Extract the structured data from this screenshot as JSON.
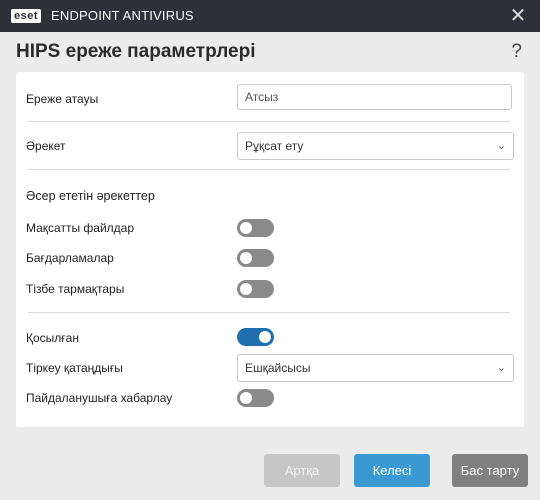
{
  "window": {
    "logo_text": "eset",
    "app_name": "ENDPOINT ANTIVIRUS",
    "close_glyph": "✕"
  },
  "dialog": {
    "title": "HIPS ереже параметрлері",
    "help_glyph": "?"
  },
  "form": {
    "rule_name_label": "Ереже атауы",
    "rule_name_placeholder": "Атсыз",
    "action_label": "Әрекет",
    "action_value": "Рұқсат ету",
    "affected_title": "Әсер ететін әрекеттер",
    "target_files_label": "Мақсатты файлдар",
    "target_files_on": false,
    "apps_label": "Бағдарламалар",
    "apps_on": false,
    "registry_label": "Тізбе тармақтары",
    "registry_on": false,
    "enabled_label": "Қосылған",
    "enabled_on": true,
    "log_label": "Тіркеу қатаңдығы",
    "log_value": "Ешқайсысы",
    "notify_label": "Пайдаланушыға хабарлау",
    "notify_on": false
  },
  "footer": {
    "back_label": "Артқа",
    "next_label": "Келесі",
    "cancel_label": "Бас тарту"
  },
  "colors": {
    "titlebar": "#2e3138",
    "toggle_on": "#1f6fb0",
    "toggle_off": "#8a8a8a",
    "primary_button": "#3b99d4"
  }
}
